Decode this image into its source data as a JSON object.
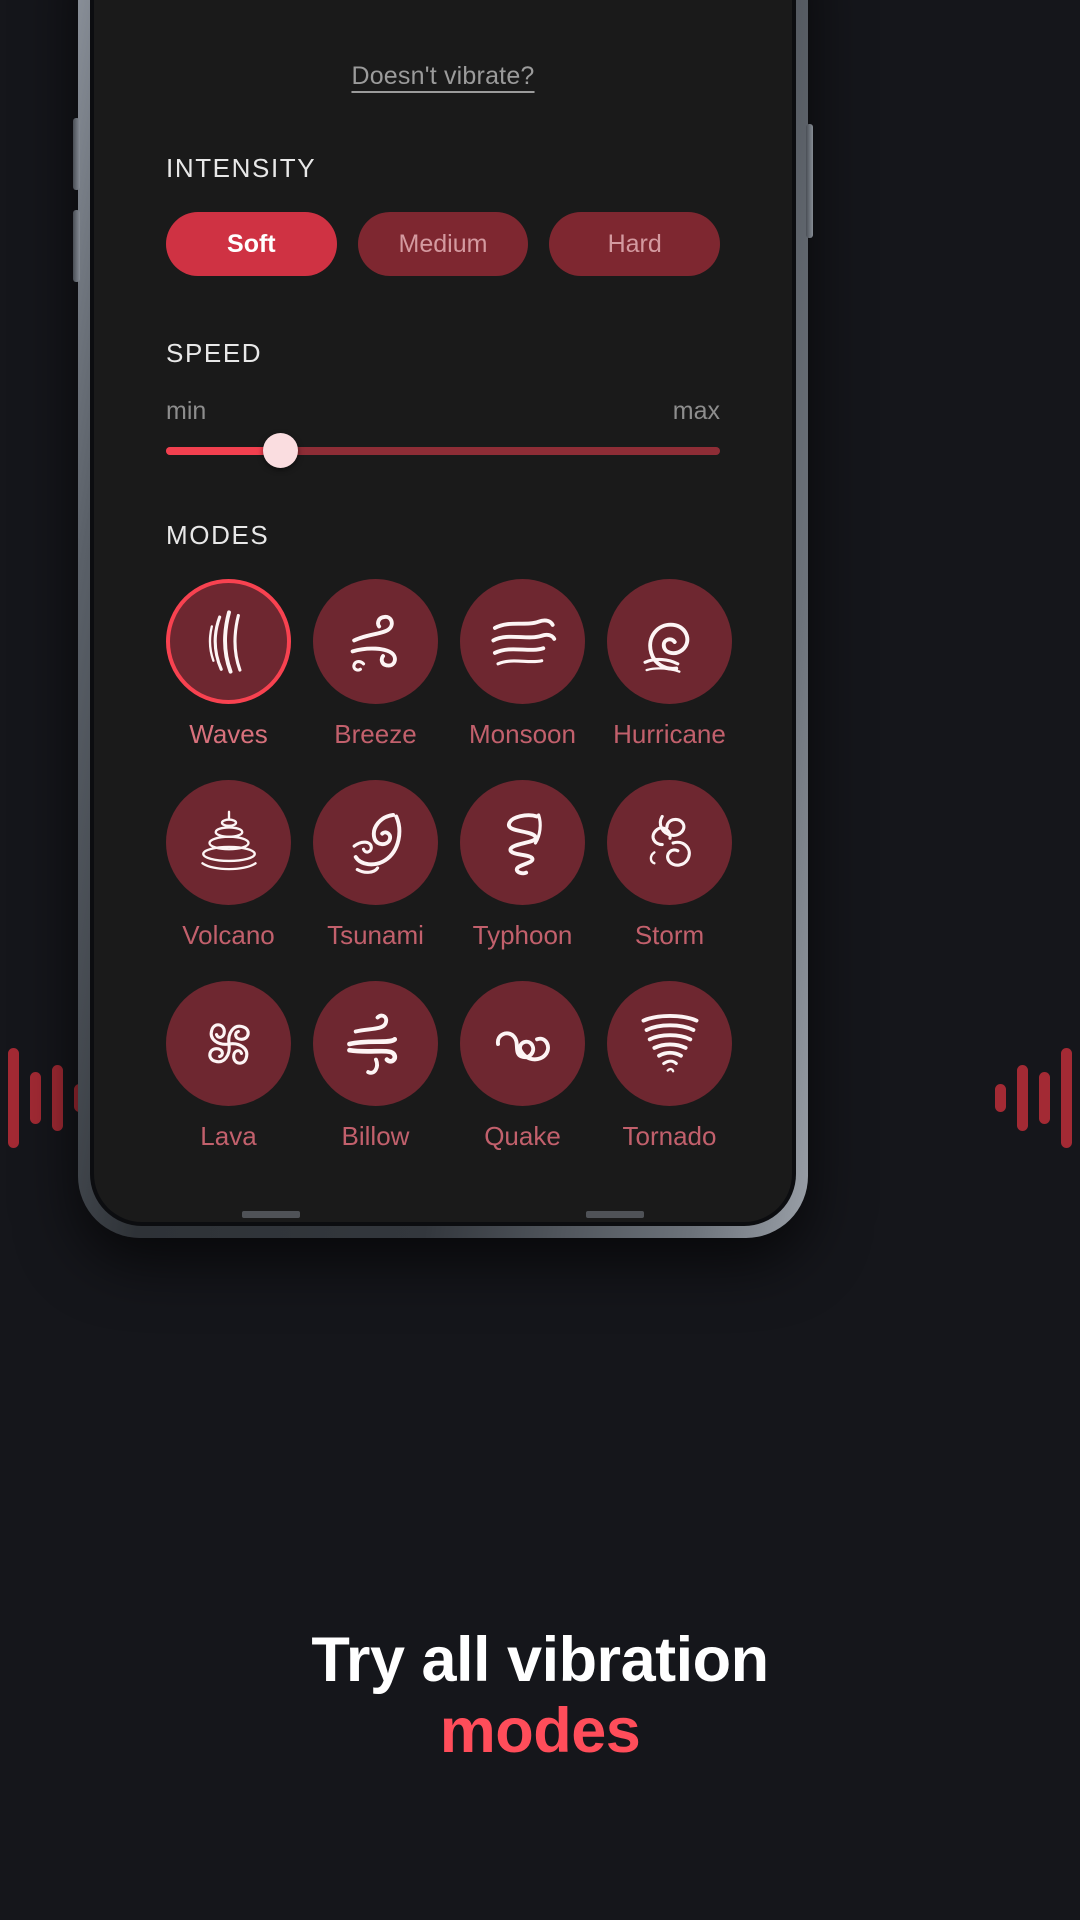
{
  "app": {
    "vibrate_link": "Doesn't vibrate?",
    "intensity": {
      "title": "INTENSITY",
      "options": [
        {
          "label": "Soft",
          "selected": true
        },
        {
          "label": "Medium",
          "selected": false
        },
        {
          "label": "Hard",
          "selected": false
        }
      ]
    },
    "speed": {
      "title": "SPEED",
      "min_label": "min",
      "max_label": "max",
      "value_percent": 20.5
    },
    "modes": {
      "title": "MODES",
      "items": [
        {
          "label": "Waves",
          "icon": "waves-icon",
          "selected": true
        },
        {
          "label": "Breeze",
          "icon": "breeze-icon",
          "selected": false
        },
        {
          "label": "Monsoon",
          "icon": "monsoon-icon",
          "selected": false
        },
        {
          "label": "Hurricane",
          "icon": "hurricane-icon",
          "selected": false
        },
        {
          "label": "Volcano",
          "icon": "volcano-icon",
          "selected": false
        },
        {
          "label": "Tsunami",
          "icon": "tsunami-icon",
          "selected": false
        },
        {
          "label": "Typhoon",
          "icon": "typhoon-icon",
          "selected": false
        },
        {
          "label": "Storm",
          "icon": "storm-icon",
          "selected": false
        },
        {
          "label": "Lava",
          "icon": "lava-icon",
          "selected": false
        },
        {
          "label": "Billow",
          "icon": "billow-icon",
          "selected": false
        },
        {
          "label": "Quake",
          "icon": "quake-icon",
          "selected": false
        },
        {
          "label": "Tornado",
          "icon": "tornado-icon",
          "selected": false
        }
      ]
    }
  },
  "promo": {
    "headline_line1": "Try all vibration",
    "headline_line2": "modes"
  },
  "colors": {
    "page_background": "#15161b",
    "screen_background": "#1a1a1a",
    "accent_red": "#f84250",
    "pill_active": "#cf3243",
    "pill_inactive": "#7e2730",
    "mode_circle": "#6e2730",
    "mode_label": "#c2606c",
    "headline_accent": "#ff4d5a",
    "waveform_bar": "#a32a34"
  },
  "decor": {
    "waveform_left_bar_heights": [
      100,
      52,
      66,
      28
    ],
    "waveform_right_bar_heights": [
      28,
      66,
      52,
      100
    ]
  }
}
